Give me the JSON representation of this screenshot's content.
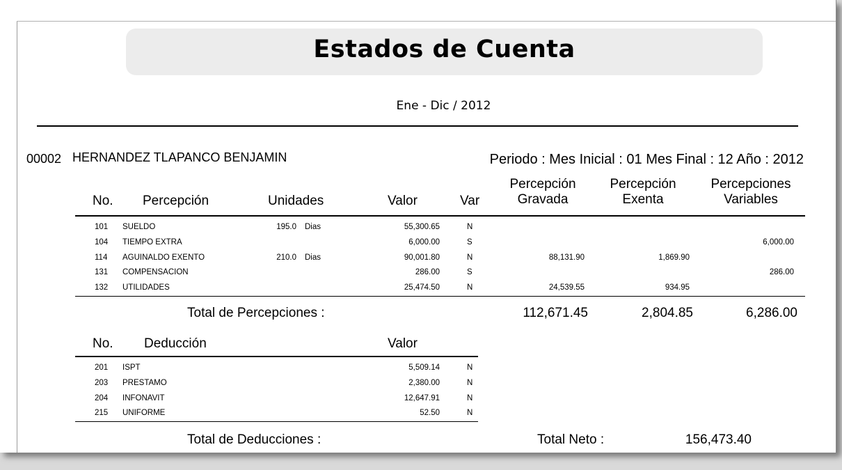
{
  "title": "Estados de Cuenta",
  "period_range": "Ene - Dic / 2012",
  "employee": {
    "number": "00002",
    "name": "HERNANDEZ TLAPANCO BENJAMIN",
    "period_line": "Periodo :  Mes Inicial : 01  Mes Final : 12  Año : 2012"
  },
  "perceptions": {
    "headers": {
      "no": "No.",
      "concept": "Percepción",
      "units": "Unidades",
      "value": "Valor",
      "var": "Var",
      "taxed_line1": "Percepción",
      "taxed_line2": "Gravada",
      "exempt_line1": "Percepción",
      "exempt_line2": "Exenta",
      "variable_line1": "Percepciones",
      "variable_line2": "Variables"
    },
    "rows": [
      {
        "no": "101",
        "concept": "SUELDO",
        "units": "195.0",
        "unit_type": "Dias",
        "value": "55,300.65",
        "var": "N",
        "taxed": "",
        "exempt": "",
        "variable": ""
      },
      {
        "no": "104",
        "concept": "TIEMPO EXTRA",
        "units": "",
        "unit_type": "",
        "value": "6,000.00",
        "var": "S",
        "taxed": "",
        "exempt": "",
        "variable": "6,000.00"
      },
      {
        "no": "114",
        "concept": "AGUINALDO EXENTO",
        "units": "210.0",
        "unit_type": "Dias",
        "value": "90,001.80",
        "var": "N",
        "taxed": "88,131.90",
        "exempt": "1,869.90",
        "variable": ""
      },
      {
        "no": "131",
        "concept": "COMPENSACION",
        "units": "",
        "unit_type": "",
        "value": "286.00",
        "var": "S",
        "taxed": "",
        "exempt": "",
        "variable": "286.00"
      },
      {
        "no": "132",
        "concept": "UTILIDADES",
        "units": "",
        "unit_type": "",
        "value": "25,474.50",
        "var": "N",
        "taxed": "24,539.55",
        "exempt": "934.95",
        "variable": ""
      }
    ],
    "total_label": "Total de Percepciones :",
    "total_taxed": "112,671.45",
    "total_exempt": "2,804.85",
    "total_variable": "6,286.00"
  },
  "deductions": {
    "headers": {
      "no": "No.",
      "concept": "Deducción",
      "value": "Valor"
    },
    "rows": [
      {
        "no": "201",
        "concept": "ISPT",
        "value": "5,509.14",
        "var": "N"
      },
      {
        "no": "203",
        "concept": "PRESTAMO",
        "value": "2,380.00",
        "var": "N"
      },
      {
        "no": "204",
        "concept": "INFONAVIT",
        "value": "12,647.91",
        "var": "N"
      },
      {
        "no": "215",
        "concept": "UNIFORME",
        "value": "52.50",
        "var": "N"
      }
    ],
    "total_label": "Total de Deducciones :"
  },
  "net": {
    "label": "Total Neto :",
    "value": "156,473.40"
  }
}
